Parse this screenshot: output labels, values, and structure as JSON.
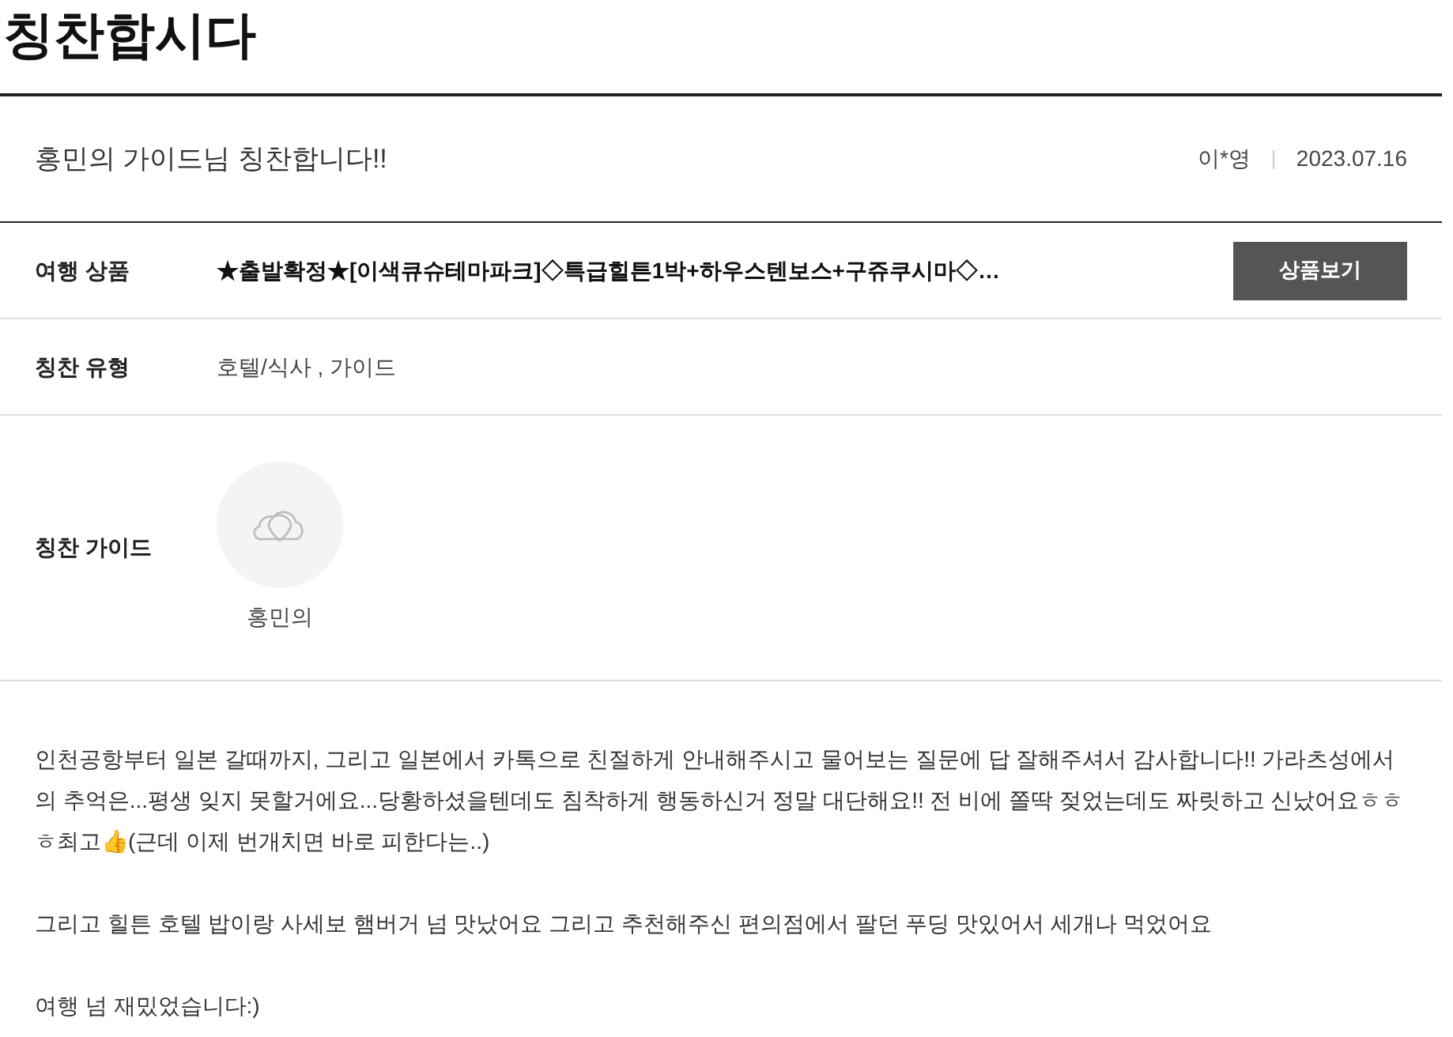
{
  "page_title": "칭찬합시다",
  "post": {
    "title": "홍민의 가이드님 칭찬합니다!!",
    "author": "이*영",
    "date": "2023.07.16"
  },
  "fields": [
    {
      "kind": "product",
      "label": "여행 상품",
      "value": "★출발확정★[이색큐슈테마파크]◇특급힐튼1박+하우스텐보스+구쥬쿠시마◇…",
      "button": "상품보기"
    },
    {
      "kind": "text",
      "label": "칭찬 유형",
      "value": "호텔/식사 , 가이드"
    },
    {
      "kind": "guide",
      "label": "칭찬 가이드",
      "guide_name": "홍민의"
    }
  ],
  "body": [
    "인천공항부터 일본 갈때까지, 그리고 일본에서 카톡으로 친절하게 안내해주시고 물어보는 질문에 답 잘해주셔서 감사합니다!! 가라츠성에서의 추억은...평생 잊지 못할거에요...당황하셨을텐데도 침착하게 행동하신거 정말 대단해요!! 전 비에 쫄딱 젖었는데도 짜릿하고 신났어요ㅎㅎㅎ최고👍(근데 이제 번개치면 바로 피한다는..)",
    "그리고 힐튼 호텔 밥이랑 사세보 햄버거 넘 맛났어요 그리고 추천해주신 편의점에서 팔던 푸딩 맛있어서 세개나 먹었어요",
    "여행 넘 재밌었습니다:)"
  ]
}
